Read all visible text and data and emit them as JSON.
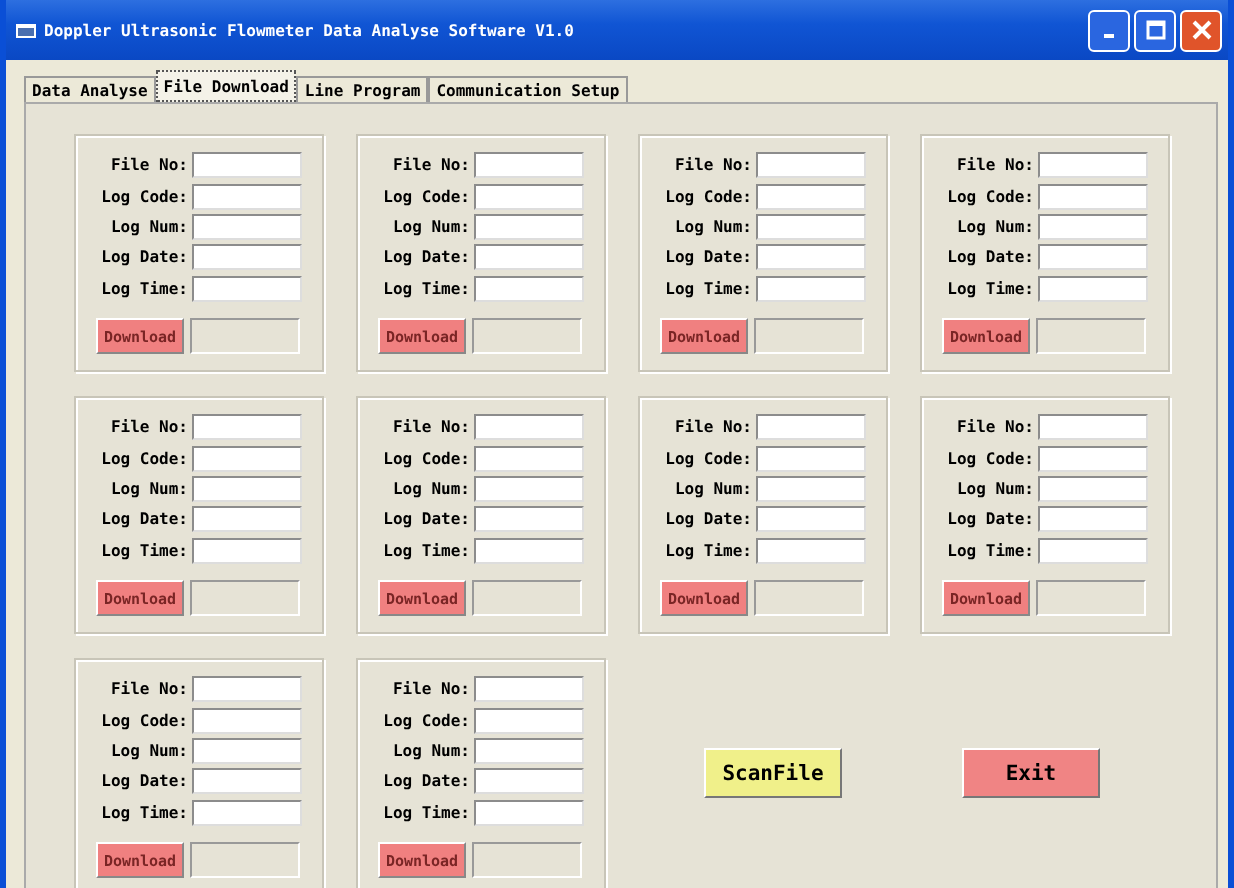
{
  "window": {
    "title": "Doppler Ultrasonic Flowmeter Data Analyse Software V1.0"
  },
  "tabs": [
    {
      "label": "Data Analyse",
      "selected": false
    },
    {
      "label": "File Download",
      "selected": true
    },
    {
      "label": "Line Program",
      "selected": false
    },
    {
      "label": "Communication Setup",
      "selected": false
    }
  ],
  "groups": [
    {
      "fields": [
        "File No:",
        "Log Code:",
        "Log Num:",
        "Log Date:",
        "Log Time:"
      ],
      "download": {
        "label": "Download",
        "disabled": true
      }
    },
    {
      "fields": [
        "File No:",
        "Log Code:",
        "Log Num:",
        "Log Date:",
        "Log Time:"
      ],
      "download": {
        "label": "Download",
        "disabled": true
      }
    },
    {
      "fields": [
        "File No:",
        "Log Code:",
        "Log Num:",
        "Log Date:",
        "Log Time:"
      ],
      "download": {
        "label": "Download",
        "disabled": true
      }
    },
    {
      "fields": [
        "File No:",
        "Log Code:",
        "Log Num:",
        "Log Date:",
        "Log Time:"
      ],
      "download": {
        "label": "Download",
        "disabled": true
      }
    },
    {
      "fields": [
        "File No:",
        "Log Code:",
        "Log Num:",
        "Log Date:",
        "Log Time:"
      ],
      "download": {
        "label": "Download",
        "disabled": true
      }
    },
    {
      "fields": [
        "File No:",
        "Log Code:",
        "Log Num:",
        "Log Date:",
        "Log Time:"
      ],
      "download": {
        "label": "Download",
        "disabled": true
      }
    },
    {
      "fields": [
        "File No:",
        "Log Code:",
        "Log Num:",
        "Log Date:",
        "Log Time:"
      ],
      "download": {
        "label": "Download",
        "disabled": true
      }
    },
    {
      "fields": [
        "File No:",
        "Log Code:",
        "Log Num:",
        "Log Date:",
        "Log Time:"
      ],
      "download": {
        "label": "Download",
        "disabled": true
      }
    },
    {
      "fields": [
        "File No:",
        "Log Code:",
        "Log Num:",
        "Log Date:",
        "Log Time:"
      ],
      "download": {
        "label": "Download",
        "disabled": true
      }
    },
    {
      "fields": [
        "File No:",
        "Log Code:",
        "Log Num:",
        "Log Date:",
        "Log Time:"
      ],
      "download": {
        "label": "Download",
        "disabled": true
      }
    }
  ],
  "scan_button": "ScanFile",
  "exit_button": "Exit"
}
